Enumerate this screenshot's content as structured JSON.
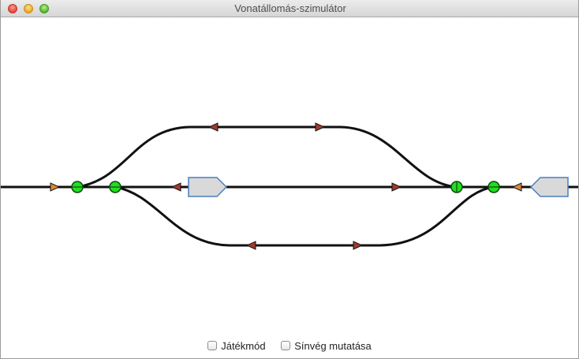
{
  "window": {
    "title": "Vonatállomás-szimulátor"
  },
  "colors": {
    "track": "#111111",
    "switch_fill": "#22dd22",
    "switch_border": "#0d4a0d",
    "signal_red": "#a33a2e",
    "signal_orange": "#d98a3a",
    "station_fill": "#d9d9d9",
    "station_border": "#4a7fc0"
  },
  "controls": {
    "game_mode_label": "Játékmód",
    "game_mode_checked": false,
    "show_track_end_label": "Sínvég mutatása",
    "show_track_end_checked": false
  }
}
